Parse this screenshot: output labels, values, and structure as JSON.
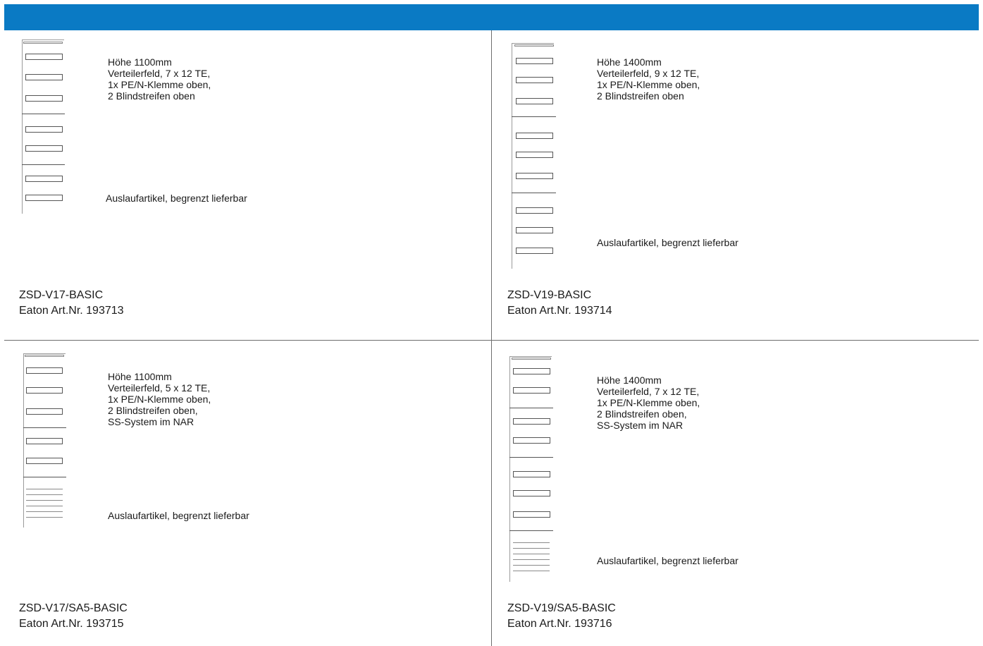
{
  "colors": {
    "banner": "#0a7ac4"
  },
  "panels": [
    {
      "desc": [
        "Höhe 1100mm",
        "Verteilerfeld, 7 x 12 TE,",
        "1x PE/N-Klemme oben,",
        "2 Blindstreifen oben"
      ],
      "note": "Auslaufartikel, begrenzt lieferbar",
      "name": "ZSD-V17-BASIC",
      "art": "Eaton Art.Nr. 193713"
    },
    {
      "desc": [
        "Höhe 1400mm",
        "Verteilerfeld, 9 x 12 TE,",
        "1x PE/N-Klemme oben,",
        "2 Blindstreifen oben"
      ],
      "note": "Auslaufartikel, begrenzt lieferbar",
      "name": "ZSD-V19-BASIC",
      "art": "Eaton Art.Nr. 193714"
    },
    {
      "desc": [
        "Höhe 1100mm",
        "Verteilerfeld, 5 x 12 TE,",
        "1x PE/N-Klemme oben,",
        "2 Blindstreifen oben,",
        "SS-System im NAR"
      ],
      "note": "Auslaufartikel, begrenzt lieferbar",
      "name": "ZSD-V17/SA5-BASIC",
      "art": "Eaton Art.Nr. 193715"
    },
    {
      "desc": [
        "Höhe 1400mm",
        "Verteilerfeld, 7 x 12 TE,",
        "1x PE/N-Klemme oben,",
        "2 Blindstreifen oben,",
        "SS-System im NAR"
      ],
      "note": "Auslaufartikel, begrenzt lieferbar",
      "name": "ZSD-V19/SA5-BASIC",
      "art": "Eaton Art.Nr. 193716"
    }
  ]
}
